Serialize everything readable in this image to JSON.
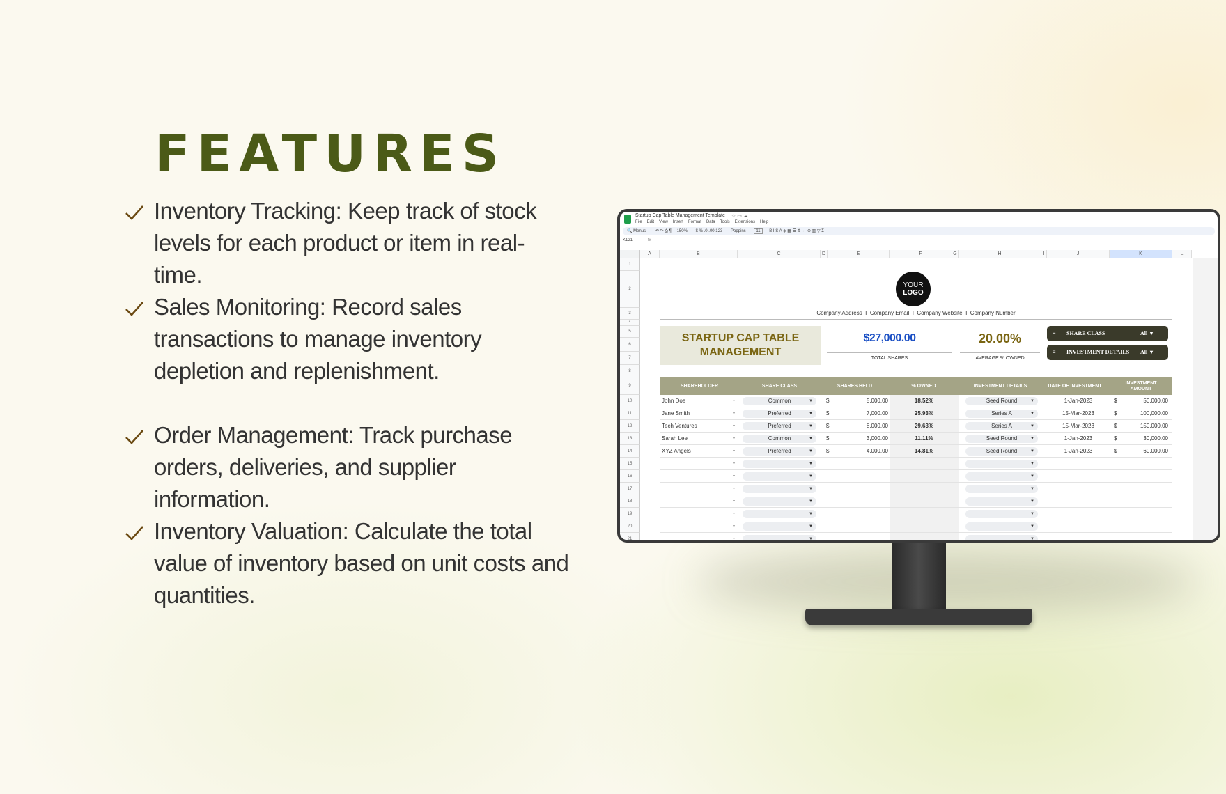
{
  "features": {
    "title": "FEATURES",
    "items": [
      {
        "text": "Inventory Tracking: Keep track of stock levels for each product or item in real-time."
      },
      {
        "text": "Sales Monitoring: Record sales transactions to manage inventory depletion and replenishment."
      },
      {
        "text": "Order Management: Track purchase orders, deliveries, and supplier information."
      },
      {
        "text": "Inventory Valuation: Calculate the total value of inventory based on unit costs and quantities."
      }
    ],
    "check_icon": "checkmark-icon",
    "title_color": "#4b5a17",
    "check_color": "#6b4a12"
  },
  "spreadsheet": {
    "doc_title": "Startup Cap Table Management Template",
    "menu": [
      "File",
      "Edit",
      "View",
      "Insert",
      "Format",
      "Data",
      "Tools",
      "Extensions",
      "Help"
    ],
    "toolbar": {
      "search": "Menus",
      "zoom": "150%",
      "font": "Poppins",
      "font_size": "11"
    },
    "cell_ref": "K121",
    "fx": "fx",
    "columns": [
      "A",
      "B",
      "C",
      "D",
      "E",
      "F",
      "G",
      "H",
      "I",
      "J",
      "K",
      "L"
    ],
    "row_numbers": [
      "1",
      "2",
      "3",
      "4",
      "5",
      "6",
      "7",
      "8",
      "9",
      "10",
      "11",
      "12",
      "13",
      "14",
      "15",
      "16",
      "17",
      "18",
      "19",
      "20",
      "21"
    ],
    "logo": {
      "line1": "YOUR",
      "line2": "LOGO"
    },
    "company_line": "Company Address  I  Company Email  I  Company Website  I  Company Number",
    "heading": {
      "line1": "STARTUP CAP TABLE",
      "line2": "MANAGEMENT"
    },
    "total_shares": {
      "value": "$27,000.00",
      "label": "TOTAL SHARES"
    },
    "avg_owned": {
      "value": "20.00%",
      "label": "AVERAGE % OWNED"
    },
    "filters": [
      {
        "label": "SHARE CLASS",
        "value": "All"
      },
      {
        "label": "INVESTMENT DETAILS",
        "value": "All"
      }
    ],
    "headers": [
      "SHAREHOLDER",
      "SHARE CLASS",
      "SHARES HELD",
      "% OWNED",
      "INVESTMENT DETAILS",
      "DATE OF INVESTMENT",
      "INVESTMENT AMOUNT"
    ],
    "rows": [
      {
        "name": "John Doe",
        "class": "Common",
        "cur": "$",
        "shares": "5,000.00",
        "owned": "18.52%",
        "details": "Seed Round",
        "date": "1-Jan-2023",
        "cur2": "$",
        "amount": "50,000.00"
      },
      {
        "name": "Jane Smith",
        "class": "Preferred",
        "cur": "$",
        "shares": "7,000.00",
        "owned": "25.93%",
        "details": "Series A",
        "date": "15-Mar-2023",
        "cur2": "$",
        "amount": "100,000.00"
      },
      {
        "name": "Tech Ventures",
        "class": "Preferred",
        "cur": "$",
        "shares": "8,000.00",
        "owned": "29.63%",
        "details": "Series A",
        "date": "15-Mar-2023",
        "cur2": "$",
        "amount": "150,000.00"
      },
      {
        "name": "Sarah Lee",
        "class": "Common",
        "cur": "$",
        "shares": "3,000.00",
        "owned": "11.11%",
        "details": "Seed Round",
        "date": "1-Jan-2023",
        "cur2": "$",
        "amount": "30,000.00"
      },
      {
        "name": "XYZ Angels",
        "class": "Preferred",
        "cur": "$",
        "shares": "4,000.00",
        "owned": "14.81%",
        "details": "Seed Round",
        "date": "1-Jan-2023",
        "cur2": "$",
        "amount": "60,000.00"
      },
      {},
      {},
      {},
      {},
      {},
      {},
      {}
    ],
    "colors": {
      "header_bg": "#a4a486",
      "heading_bg": "#e9e9dc",
      "heading_text": "#7a6512",
      "total_blue": "#1a4fc4",
      "filter_bg": "#3a3a2a"
    }
  }
}
